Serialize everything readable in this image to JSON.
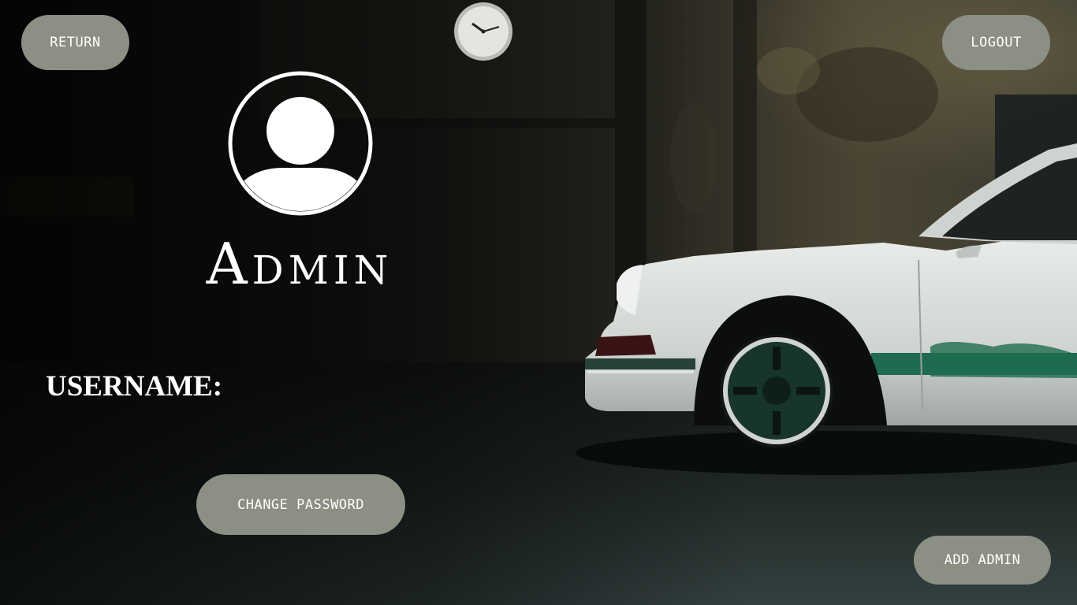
{
  "header": {
    "return_label": "RETURN",
    "logout_label": "LOGOUT"
  },
  "profile": {
    "role_title": "Admin",
    "username_label": "USERNAME:",
    "username_value": ""
  },
  "actions": {
    "change_password_label": "CHANGE PASSWORD",
    "add_admin_label": "ADD ADMIN"
  },
  "icons": {
    "avatar": "user-avatar-icon",
    "clock": "wall-clock"
  },
  "colors": {
    "button_bg": "#8b8f84",
    "button_text": "#ffffff",
    "text": "#ffffff",
    "car_stripe": "#1f6b4f"
  }
}
